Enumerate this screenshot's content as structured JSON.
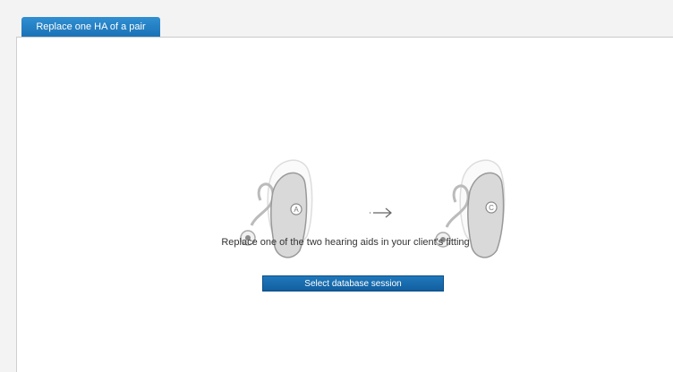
{
  "tabs": [
    {
      "label": "Replace one HA of a pair",
      "active": true
    }
  ],
  "main": {
    "caption": "Replace one of the two hearing aids in your client's fitting",
    "select_button_label": "Select database session",
    "illustration": {
      "left_aid_letter": "A",
      "right_aid_letter": "C",
      "arrow_icon": "arrow-right-icon"
    }
  },
  "colors": {
    "accent": "#1b72b6",
    "panel_bg": "#ffffff",
    "window_bg": "#f3f3f3"
  }
}
